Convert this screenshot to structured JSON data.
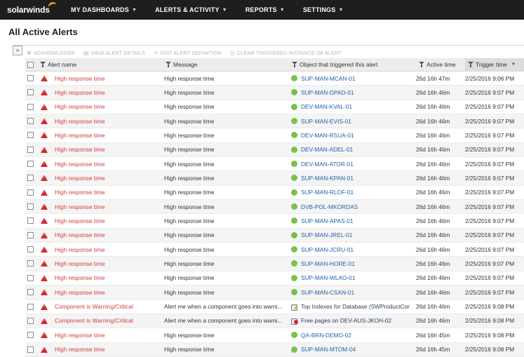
{
  "brand": {
    "name": "solarwinds",
    "accent": "#f99d1c"
  },
  "nav": [
    {
      "label": "MY DASHBOARDS"
    },
    {
      "label": "ALERTS & ACTIVITY"
    },
    {
      "label": "REPORTS"
    },
    {
      "label": "SETTINGS"
    }
  ],
  "page": {
    "title": "All Active Alerts"
  },
  "toolbar": [
    {
      "label": "ACKNOWLEDGE",
      "icon": "acknowledge-icon",
      "glyph": "✖"
    },
    {
      "label": "VIEW ALERT DETAILS",
      "icon": "view-details-icon",
      "glyph": "▤"
    },
    {
      "label": "EDIT ALERT DEFINITION",
      "icon": "edit-icon",
      "glyph": "✎"
    },
    {
      "label": "CLEAR TRIGGERED INSTANCE OF ALERT",
      "icon": "clear-icon",
      "glyph": "◎"
    }
  ],
  "columns": {
    "alert_name": "Alert name",
    "message": "Message",
    "object": "Object that triggered this alert",
    "active_time": "Active time",
    "trigger_time": "Trigger time"
  },
  "colors": {
    "alert_red": "#d9262e",
    "status_up": "#78c14a",
    "warning": "#f2b52a"
  },
  "rows": [
    {
      "name": "High response time",
      "message": "High response time",
      "object": "SUP-MAN-MCAN-01",
      "icon": "status-up-icon",
      "active": "26d 16h 47m",
      "trigger": "2/25/2016 9:06 PM"
    },
    {
      "name": "High response time",
      "message": "High response time",
      "object": "SUP-MAN-DPAD-01",
      "icon": "status-up-icon",
      "active": "26d 16h 46m",
      "trigger": "2/25/2016 9:07 PM"
    },
    {
      "name": "High response time",
      "message": "High response time",
      "object": "DEV-MAN-KVAL-01",
      "icon": "status-up-icon",
      "active": "26d 16h 46m",
      "trigger": "2/25/2016 9:07 PM"
    },
    {
      "name": "High response time",
      "message": "High response time",
      "object": "SUP-MAN-EVIS-01",
      "icon": "status-up-icon",
      "active": "26d 16h 46m",
      "trigger": "2/25/2016 9:07 PM"
    },
    {
      "name": "High response time",
      "message": "High response time",
      "object": "DEV-MAN-RSUA-01",
      "icon": "status-up-icon",
      "active": "26d 16h 46m",
      "trigger": "2/25/2016 9:07 PM"
    },
    {
      "name": "High response time",
      "message": "High response time",
      "object": "DEV-MAN-ADEL-01",
      "icon": "status-up-icon",
      "active": "26d 16h 46m",
      "trigger": "2/25/2016 9:07 PM"
    },
    {
      "name": "High response time",
      "message": "High response time",
      "object": "DEV-MAN-ATOR-01",
      "icon": "status-up-icon",
      "active": "26d 16h 46m",
      "trigger": "2/25/2016 9:07 PM"
    },
    {
      "name": "High response time",
      "message": "High response time",
      "object": "SUP-MAN-KPAN-01",
      "icon": "status-up-icon",
      "active": "26d 16h 46m",
      "trigger": "2/25/2016 9:07 PM"
    },
    {
      "name": "High response time",
      "message": "High response time",
      "object": "SUP-MAN-RLOF-01",
      "icon": "status-up-icon",
      "active": "26d 16h 46m",
      "trigger": "2/25/2016 9:07 PM"
    },
    {
      "name": "High response time",
      "message": "High response time",
      "object": "DVB-POL-MKORDAS",
      "icon": "status-up-icon",
      "active": "26d 16h 46m",
      "trigger": "2/25/2016 9:07 PM"
    },
    {
      "name": "High response time",
      "message": "High response time",
      "object": "SUP-MAN-APAS-01",
      "icon": "status-up-icon",
      "active": "26d 16h 46m",
      "trigger": "2/25/2016 9:07 PM"
    },
    {
      "name": "High response time",
      "message": "High response time",
      "object": "SUP-MAN-JREL-01",
      "icon": "status-up-icon",
      "active": "26d 16h 46m",
      "trigger": "2/25/2016 9:07 PM"
    },
    {
      "name": "High response time",
      "message": "High response time",
      "object": "SUP-MAN-JCRU-01",
      "icon": "status-up-icon",
      "active": "26d 16h 46m",
      "trigger": "2/25/2016 9:07 PM"
    },
    {
      "name": "High response time",
      "message": "High response time",
      "object": "SUP-MAN-HORE-01",
      "icon": "status-up-icon",
      "active": "26d 16h 46m",
      "trigger": "2/25/2016 9:07 PM"
    },
    {
      "name": "High response time",
      "message": "High response time",
      "object": "SUP-MAN-WLAO-01",
      "icon": "status-up-icon",
      "active": "26d 16h 46m",
      "trigger": "2/25/2016 9:07 PM"
    },
    {
      "name": "High response time",
      "message": "High response time",
      "object": "SUP-MAN-CSAN-01",
      "icon": "status-up-icon",
      "active": "26d 16h 46m",
      "trigger": "2/25/2016 9:07 PM"
    },
    {
      "name": "Component is Warning/Critical",
      "message": "Alert me when a component goes into warni...",
      "object": "Top Indexes for Database (SWProductCor",
      "icon": "component-warning-icon",
      "active": "26d 16h 46m",
      "trigger": "2/25/2016 9:08 PM"
    },
    {
      "name": "Component is Warning/Critical",
      "message": "Alert me when a component goes into warni...",
      "object": "Free pages on DEV-AUS-JKOH-02",
      "icon": "component-critical-icon",
      "active": "26d 16h 46m",
      "trigger": "2/25/2016 9:08 PM"
    },
    {
      "name": "High response time",
      "message": "High response time",
      "object": "QA-BRN-DEMO-02",
      "icon": "status-up-icon",
      "active": "26d 16h 45m",
      "trigger": "2/25/2016 9:08 PM"
    },
    {
      "name": "High response time",
      "message": "High response time",
      "object": "SUP-MAN-MTOM-04",
      "icon": "status-up-icon",
      "active": "26d 16h 45m",
      "trigger": "2/25/2016 9:08 PM"
    }
  ]
}
